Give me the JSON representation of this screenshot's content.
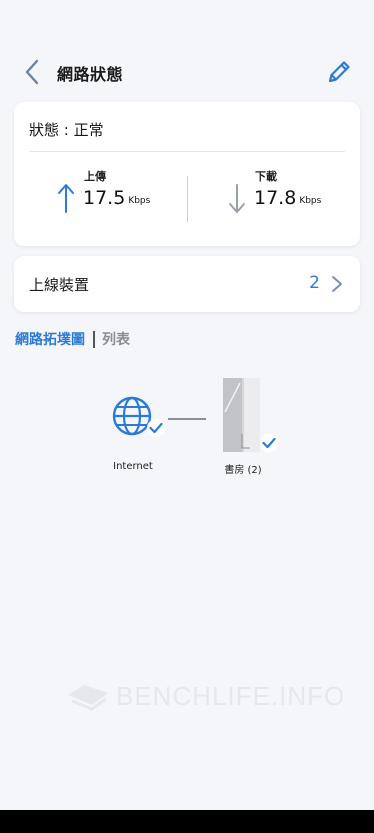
{
  "header": {
    "title": "網路狀態",
    "back_icon": "chevron-left-icon",
    "edit_icon": "pencil-icon"
  },
  "status": {
    "text": "狀態 : 正常",
    "upload": {
      "label": "上傳",
      "value": "17.5",
      "unit": "Kbps",
      "icon": "arrow-up-icon"
    },
    "download": {
      "label": "下載",
      "value": "17.8",
      "unit": "Kbps",
      "icon": "arrow-down-icon"
    }
  },
  "devices": {
    "label": "上線裝置",
    "count": "2",
    "icon": "chevron-right-icon"
  },
  "tabs": [
    {
      "label": "網路拓墣圖",
      "active": true
    },
    {
      "label": "列表",
      "active": false
    }
  ],
  "topology": {
    "internet": {
      "label": "Internet",
      "icon": "globe-icon",
      "status_icon": "check-icon"
    },
    "router": {
      "label": "書房 (2)",
      "icon": "router-icon",
      "status_icon": "check-icon"
    }
  },
  "watermark": "BENCHLIFE.INFO",
  "colors": {
    "accent": "#2b7bd6",
    "background": "#f5f6fa",
    "upload_arrow": "#2b7bd6",
    "download_arrow": "#9aa0a8"
  }
}
